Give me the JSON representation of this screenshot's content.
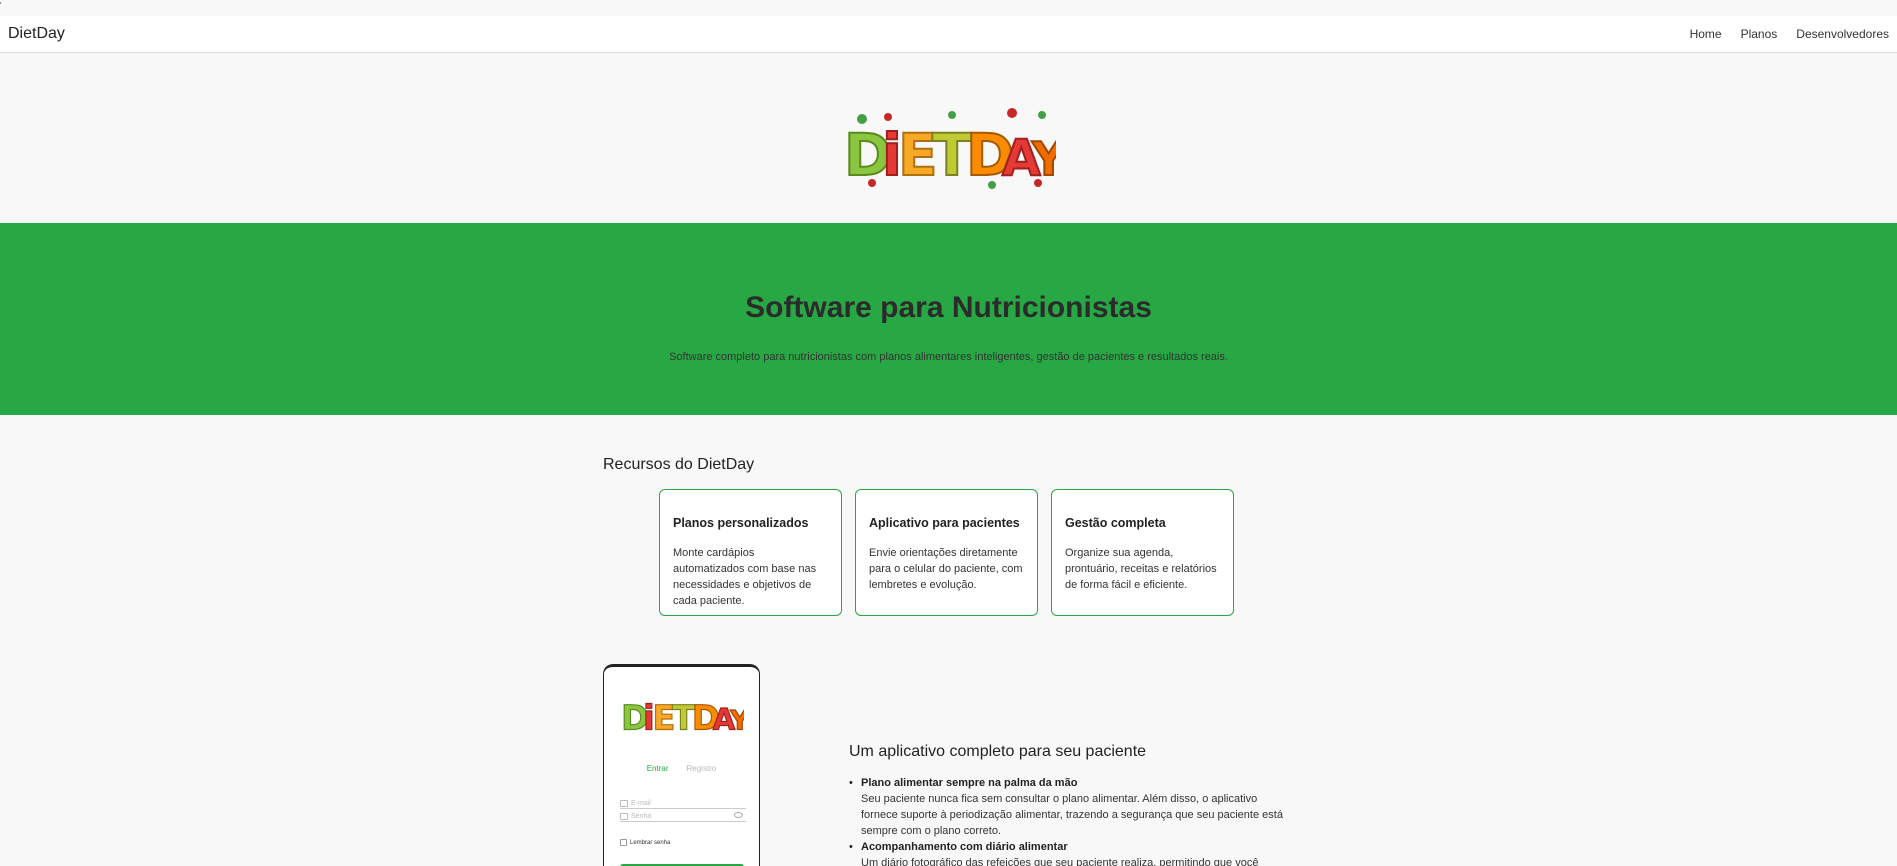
{
  "corner_mark": "'",
  "navbar": {
    "brand": "DietDay",
    "links": [
      "Home",
      "Planos",
      "Desenvolvedores"
    ]
  },
  "logo": {
    "text": "DiETDAY"
  },
  "hero": {
    "title": "Software para Nutricionistas",
    "subtitle": "Software completo para nutricionistas com planos alimentares inteligentes, gestão de pacientes e resultados reais."
  },
  "features": {
    "heading": "Recursos do DietDay",
    "cards": [
      {
        "title": "Planos personalizados",
        "text": "Monte cardápios automatizados com base nas necessidades e objetivos de cada paciente."
      },
      {
        "title": "Aplicativo para pacientes",
        "text": "Envie orientações diretamente para o celular do paciente, com lembretes e evolução."
      },
      {
        "title": "Gestão completa",
        "text": "Organize sua agenda, prontuário, receitas e relatórios de forma fácil e eficiente."
      }
    ]
  },
  "phone": {
    "tab_login": "Entrar",
    "tab_register": "Registro",
    "email_placeholder": "E-mail",
    "password_placeholder": "Senha",
    "remember": "Lembrar senha"
  },
  "app": {
    "heading": "Um aplicativo completo para seu paciente",
    "items": [
      {
        "title": "Plano alimentar sempre na palma da mão",
        "text": "Seu paciente nunca fica sem consultar o plano alimentar. Além disso, o aplicativo fornece suporte à periodização alimentar, trazendo a segurança que seu paciente está sempre com o plano correto."
      },
      {
        "title": "Acompanhamento com diário alimentar",
        "text": "Um diário fotográfico das refeições que seu paciente realiza, permitindo que você"
      }
    ]
  },
  "colors": {
    "accent": "#28a745",
    "background": "#f8f8f8"
  }
}
